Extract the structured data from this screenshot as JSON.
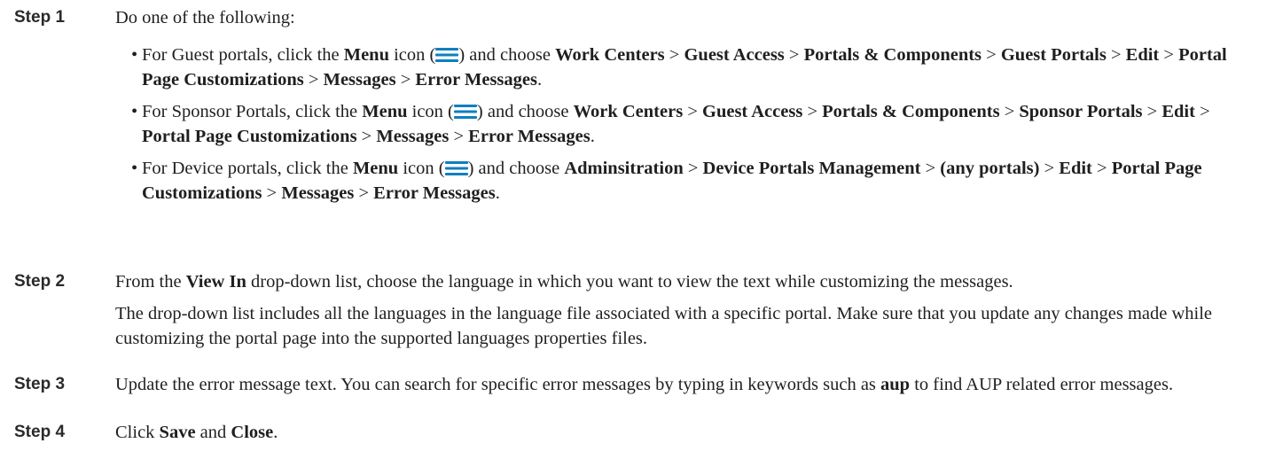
{
  "steps": [
    {
      "label": "Step 1",
      "intro": "Do one of the following:",
      "bullets": [
        {
          "prefix": "For Guest portals, click the",
          "menu": "Menu",
          "icon_text": "icon (",
          "icon_close": ") and choose",
          "path": [
            {
              "t": "Work Centers",
              "sep": ">"
            },
            {
              "t": "Guest Access",
              "sep": ">"
            },
            {
              "t": "Portals & Components",
              "sep": ">"
            },
            {
              "t": "Guest Portals",
              "sep": ">"
            },
            {
              "t": "Edit",
              "sep": ">"
            },
            {
              "t": "Portal Page Customizations",
              "sep": ">"
            },
            {
              "t": "Messages",
              "sep": ">"
            },
            {
              "t": "Error Messages",
              "sep": "."
            }
          ]
        },
        {
          "prefix": "For Sponsor Portals, click the",
          "menu": "Menu",
          "icon_text": "icon (",
          "icon_close": ") and choose",
          "path": [
            {
              "t": "Work Centers",
              "sep": ">"
            },
            {
              "t": "Guest Access",
              "sep": ">"
            },
            {
              "t": "Portals & Components",
              "sep": ">"
            },
            {
              "t": "Sponsor Portals",
              "sep": ">"
            },
            {
              "t": "Edit",
              "sep": ">"
            },
            {
              "t": "Portal Page Customizations",
              "sep": ">"
            },
            {
              "t": "Messages",
              "sep": ">"
            },
            {
              "t": "Error Messages",
              "sep": "."
            }
          ]
        },
        {
          "prefix": "For Device portals, click the",
          "menu": "Menu",
          "icon_text": "icon (",
          "icon_close": ") and choose",
          "path": [
            {
              "t": "Adminsitration",
              "sep": ">"
            },
            {
              "t": "Device Portals Management",
              "sep": ">"
            },
            {
              "t": "(any portals)",
              "sep": ">"
            },
            {
              "t": "Edit",
              "sep": ">"
            },
            {
              "t": "Portal Page Customizations",
              "sep": ">"
            },
            {
              "t": "Messages",
              "sep": ">"
            },
            {
              "t": "Error Messages",
              "sep": "."
            }
          ]
        }
      ]
    },
    {
      "label": "Step 2",
      "p1_before": "From the",
      "p1_bold": "View In",
      "p1_after": "drop-down list, choose the language in which you want to view the text while customizing the messages.",
      "p2": "The drop-down list includes all the languages in the language file associated with a specific portal. Make sure that you update any changes made while customizing the portal page into the supported languages properties files."
    },
    {
      "label": "Step 3",
      "before": "Update the error message text. You can search for specific error messages by typing in keywords such as",
      "bold": "aup",
      "after": "to find AUP related error messages."
    },
    {
      "label": "Step 4",
      "before": "Click",
      "bold1": "Save",
      "mid": "and",
      "bold2": "Close",
      "end": "."
    }
  ],
  "colors": {
    "menu_icon": "#0e7fc0",
    "text": "#1f1f1f"
  },
  "icons": {
    "menu": "hamburger-menu-icon"
  }
}
